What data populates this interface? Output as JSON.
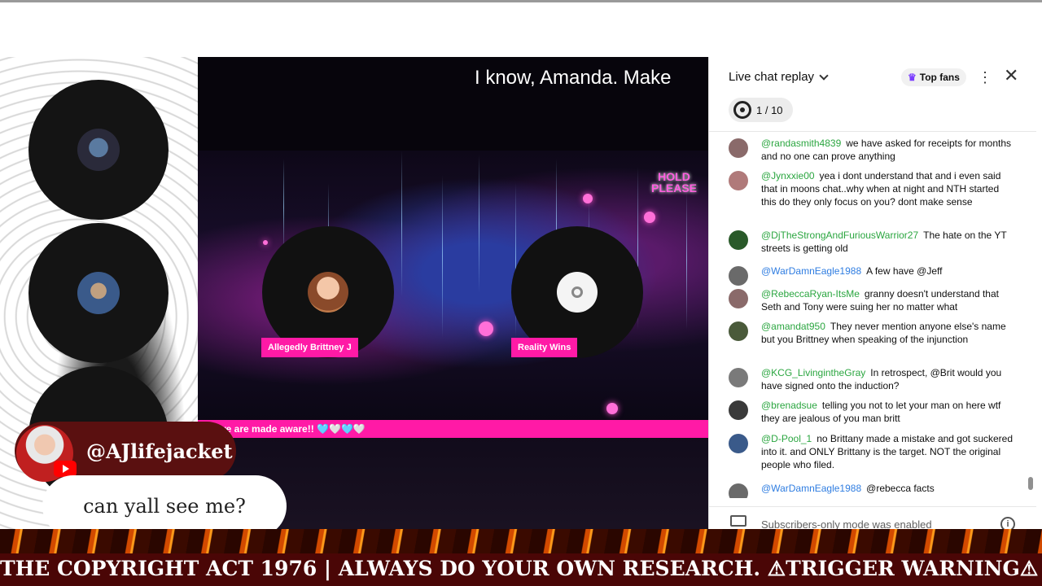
{
  "stream": {
    "caption": "I know, Amanda. Make",
    "hold_label": "HOLD PLEASE",
    "pink_ticker": "t we are made aware!! 🩵🤍🩵🤍",
    "guests": [
      {
        "name": "Allegedly Brittney J"
      },
      {
        "name": "Reality Wins"
      }
    ]
  },
  "chat": {
    "title": "Live chat replay",
    "top_fans_label": "Top fans",
    "goal": "1 / 10",
    "footer": "Subscribers-only mode was enabled",
    "messages": [
      {
        "author": "@randasmith4839",
        "text": "we have asked for receipts for months and no one can prove anything",
        "avatar_color": "#8a6a6a"
      },
      {
        "author": "@Jynxxie00",
        "text": "yea i dont understand that and i even said that in moons chat..why when at night and NTH started this do they only focus on you? dont make sense",
        "avatar_color": "#b07a7a"
      },
      {
        "author": "@DjTheStrongAndFuriousWarrior27",
        "text": "The hate on the YT streets is getting old",
        "avatar_color": "#2a5a2a"
      },
      {
        "author": "@WarDamnEagle1988",
        "text": "A few have @Jeff",
        "avatar_color": "#6a6a6a",
        "moderator": true
      },
      {
        "author": "@RebeccaRyan-ItsMe",
        "text": "granny doesn't understand that Seth and Tony were suing her no matter what",
        "avatar_color": "#8a6a6a"
      },
      {
        "author": "@amandat950",
        "text": "They never mention anyone else's name but you Brittney when speaking of the injunction",
        "avatar_color": "#4a5a3a"
      },
      {
        "author": "@KCG_LivingintheGray",
        "text": "In retrospect, @Brit would you have signed onto the induction?",
        "avatar_color": "#7a7a7a"
      },
      {
        "author": "@brenadsue",
        "text": "telling you not to let your man on here wtf they are jealous of you man britt",
        "avatar_color": "#3a3a3a"
      },
      {
        "author": "@D-Pool_1",
        "text": "no Brittany made a mistake and got suckered into it. and ONLY Brittany is the target. NOT the original people who filed.",
        "avatar_color": "#3a5a8a"
      },
      {
        "author": "@WarDamnEagle1988",
        "text": "@rebecca facts",
        "avatar_color": "#6a6a6a",
        "moderator": true
      }
    ]
  },
  "overlay": {
    "commenter_name": "@AJlifejacket",
    "comment": "can yall see me?"
  },
  "ticker": "THE COPYRIGHT ACT 1976 | ALWAYS DO YOUR OWN RESEARCH. ⚠TRIGGER WARNING⚠ - SAMHSA'"
}
